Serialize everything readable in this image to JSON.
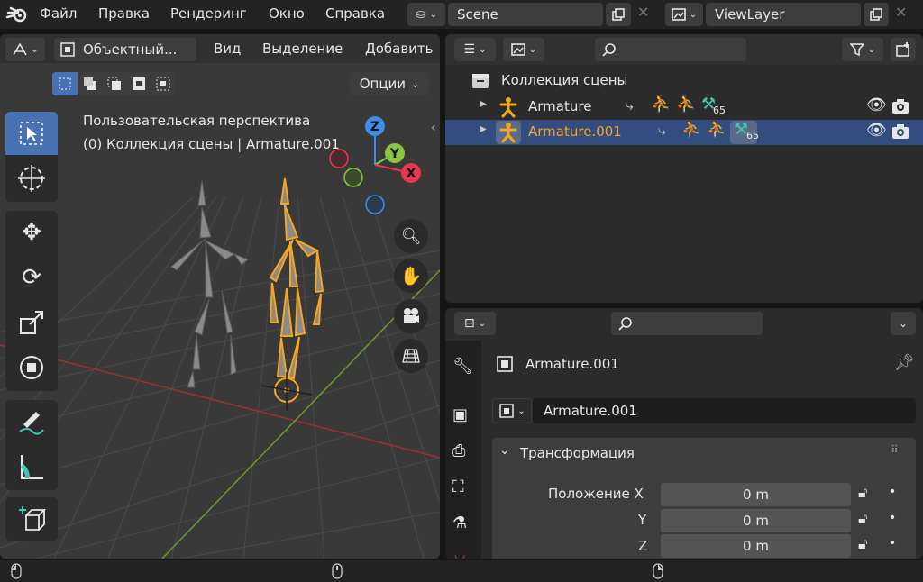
{
  "topbar": {
    "menus": [
      "Файл",
      "Правка",
      "Рендеринг",
      "Окно",
      "Справка"
    ],
    "scene_name": "Scene",
    "viewlayer_name": "ViewLayer"
  },
  "viewport": {
    "mode_label": "Объектный...",
    "menus": [
      "Вид",
      "Выделение",
      "Добавить"
    ],
    "options_label": "Опции",
    "overlay_title": "Пользовательская перспектива",
    "overlay_subtitle": "(0) Коллекция сцены | Armature.001",
    "gizmo": {
      "z": "Z",
      "y": "Y",
      "x": "X"
    }
  },
  "outliner": {
    "collection_label": "Коллекция сцены",
    "rows": [
      {
        "name": "Armature",
        "badge": "65",
        "selected": false
      },
      {
        "name": "Armature.001",
        "badge": "65",
        "selected": true
      }
    ]
  },
  "properties": {
    "object_name": "Armature.001",
    "object_field": "Armature.001",
    "panel_title": "Трансформация",
    "location_label": "Положение X",
    "axis_labels": [
      "Y",
      "Z"
    ],
    "values": [
      "0 m",
      "0 m",
      "0 m"
    ]
  },
  "colors": {
    "accent_selected": "#334d80",
    "orange": "#f5a623",
    "teal": "#3ec7b3",
    "axis_x": "#e8384f",
    "axis_y": "#8cc63f",
    "axis_z": "#3d8ee8"
  }
}
